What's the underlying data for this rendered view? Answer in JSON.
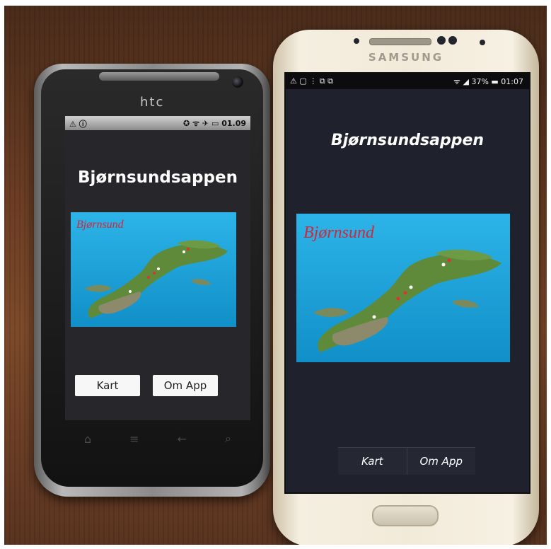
{
  "htc": {
    "brand": "htc",
    "status_left": "⚠ ⓘ",
    "status_right": "✪ ᯤ ✈ ▭ 01.09",
    "time": "01.09",
    "app_title": "Bjørnsundsappen",
    "logo_text": "Bjørnsund",
    "buttons": {
      "map": "Kart",
      "about": "Om App"
    },
    "nav_keys": {
      "home": "⌂",
      "menu": "≡",
      "back": "←",
      "search": "⌕"
    }
  },
  "samsung": {
    "brand": "SAMSUNG",
    "status_left": "⚠ ▢ ⋮ ⧉ ⧉",
    "battery": "37%",
    "time": "01:07",
    "app_title": "Bjørnsundsappen",
    "logo_text": "Bjørnsund",
    "buttons": {
      "map": "Kart",
      "about": "Om App"
    }
  },
  "colors": {
    "logo_red": "#d0283c",
    "sea": "#1aa6de",
    "land": "#5f8a3a"
  }
}
